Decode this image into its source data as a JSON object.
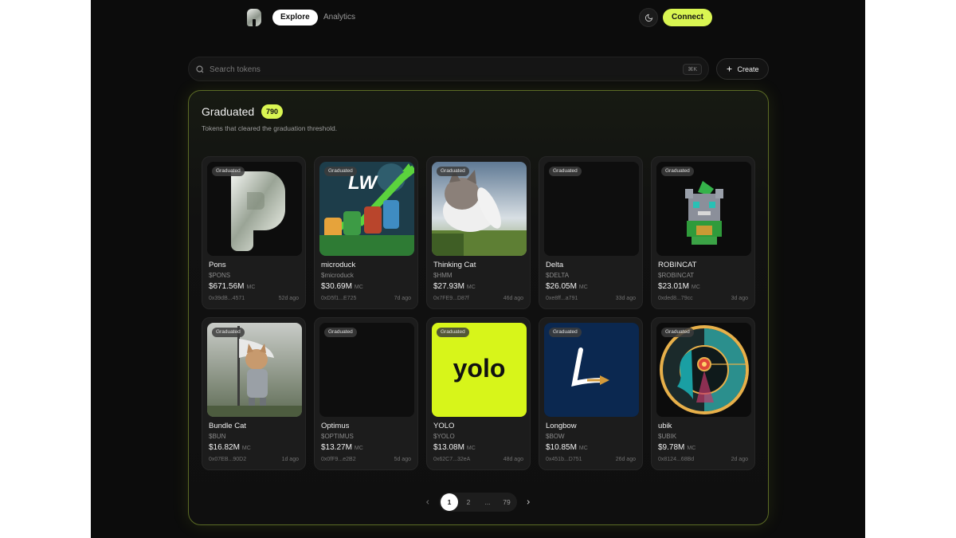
{
  "nav": {
    "tabs": [
      {
        "label": "Explore",
        "active": true
      },
      {
        "label": "Analytics",
        "active": false
      }
    ],
    "connect_label": "Connect",
    "theme_icon": "moon-icon"
  },
  "search": {
    "placeholder": "Search tokens",
    "shortcut": "⌘K",
    "create_label": "Create"
  },
  "section": {
    "title": "Graduated",
    "count": "790",
    "subtitle": "Tokens that cleared the graduation threshold."
  },
  "badge_label": "Graduated",
  "mc_unit": "MC",
  "tokens": [
    {
      "name": "Pons",
      "symbol": "$PONS",
      "mc": "$671.56M",
      "address": "0x39dB...4571",
      "age": "52d ago",
      "image": "pons"
    },
    {
      "name": "microduck",
      "symbol": "$microduck",
      "mc": "$30.69M",
      "address": "0xD5f1...E725",
      "age": "7d ago",
      "image": "lw"
    },
    {
      "name": "Thinking Cat",
      "symbol": "$HMM",
      "mc": "$27.93M",
      "address": "0x7FE9...D87f",
      "age": "46d ago",
      "image": "cat"
    },
    {
      "name": "Delta",
      "symbol": "$DELTA",
      "mc": "$26.05M",
      "address": "0xe8ff...a791",
      "age": "33d ago",
      "image": "blank"
    },
    {
      "name": "ROBINCAT",
      "symbol": "$ROBINCAT",
      "mc": "$23.01M",
      "address": "0xded8...79cc",
      "age": "3d ago",
      "image": "robin"
    },
    {
      "name": "Bundle Cat",
      "symbol": "$BUN",
      "mc": "$16.82M",
      "address": "0x07EB...90D2",
      "age": "1d ago",
      "image": "knight"
    },
    {
      "name": "Optimus",
      "symbol": "$OPTIMUS",
      "mc": "$13.27M",
      "address": "0x0fF9...e2B2",
      "age": "5d ago",
      "image": "blank"
    },
    {
      "name": "YOLO",
      "symbol": "$YOLO",
      "mc": "$13.08M",
      "address": "0x62C7...32eA",
      "age": "48d ago",
      "image": "yolo",
      "image_text": "yolo"
    },
    {
      "name": "Longbow",
      "symbol": "$BOW",
      "mc": "$10.85M",
      "address": "0x451b...D751",
      "age": "26d ago",
      "image": "longbow"
    },
    {
      "name": "ubik",
      "symbol": "$UBIK",
      "mc": "$9.78M",
      "address": "0x8124...68Bd",
      "age": "2d ago",
      "image": "ubik"
    }
  ],
  "pagination": {
    "pages": [
      "1",
      "2",
      "...",
      "79"
    ],
    "current": "1"
  },
  "colors": {
    "accent": "#d9f552",
    "background": "#0c0c0c",
    "card": "#1c1c1c"
  }
}
